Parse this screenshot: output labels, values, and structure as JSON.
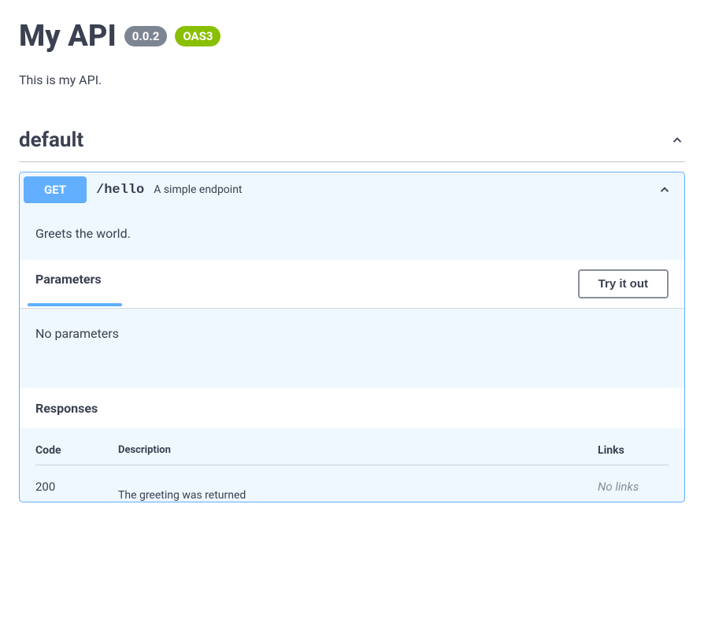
{
  "header": {
    "title": "My API",
    "version": "0.0.2",
    "oas": "OAS3",
    "description": "This is my API."
  },
  "tag": {
    "name": "default"
  },
  "operation": {
    "method": "GET",
    "path": "/hello",
    "summary": "A simple endpoint",
    "description": "Greets the world.",
    "parameters_label": "Parameters",
    "try_label": "Try it out",
    "no_params": "No parameters",
    "responses_label": "Responses",
    "columns": {
      "code": "Code",
      "description": "Description",
      "links": "Links"
    },
    "responses": [
      {
        "code": "200",
        "description": "The greeting was returned",
        "links": "No links"
      }
    ]
  }
}
